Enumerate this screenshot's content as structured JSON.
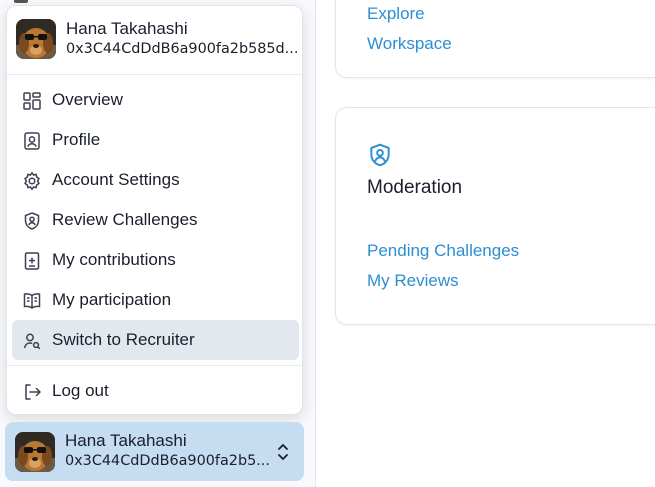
{
  "user": {
    "name": "Hana Takahashi",
    "address_menu": "0x3C44CdDdB6a900fa2b585d...",
    "address_switcher": "0x3C44CdDdB6a900fa2b5..."
  },
  "menu": {
    "items": [
      {
        "label": "Overview",
        "icon": "grid-icon"
      },
      {
        "label": "Profile",
        "icon": "profile-card-icon"
      },
      {
        "label": "Account Settings",
        "icon": "gear-icon"
      },
      {
        "label": "Review Challenges",
        "icon": "shield-user-icon"
      },
      {
        "label": "My contributions",
        "icon": "add-document-icon"
      },
      {
        "label": "My participation",
        "icon": "book-icon"
      },
      {
        "label": "Switch to Recruiter",
        "icon": "user-search-icon"
      }
    ],
    "logout_label": "Log out"
  },
  "main": {
    "top_card": {
      "links": [
        "Explore",
        "Workspace"
      ]
    },
    "moderation": {
      "title": "Moderation",
      "links": [
        "Pending Challenges",
        "My Reviews"
      ]
    }
  },
  "colors": {
    "link": "#2b8fd1",
    "active_item_bg": "#e3e8ef",
    "switcher_bg": "#c6dcf1"
  }
}
